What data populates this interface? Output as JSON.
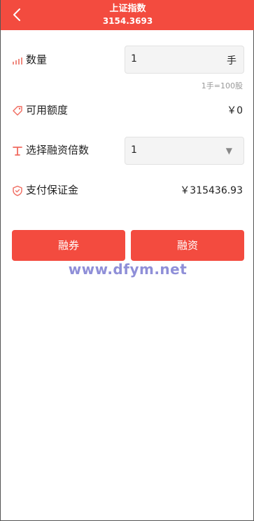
{
  "header": {
    "title": "上证指数",
    "subtitle": "3154.3693",
    "back_icon": "chevron-left-icon",
    "background": "#f34b3f"
  },
  "form": {
    "quantity": {
      "label": "数量",
      "icon": "signal-bars-icon",
      "value": "1",
      "unit": "手",
      "hint": "1手=100股"
    },
    "available_credit": {
      "label": "可用额度",
      "icon": "tag-icon",
      "value": "￥0"
    },
    "leverage": {
      "label": "选择融资倍数",
      "icon": "text-t-icon",
      "selected": "1",
      "arrow": "▼"
    },
    "margin": {
      "label": "支付保证金",
      "icon": "shield-icon",
      "value": "￥315436.93"
    }
  },
  "actions": {
    "short_label": "融券",
    "long_label": "融资",
    "color": "#f34b3f"
  },
  "watermark": "www.dfym.net"
}
